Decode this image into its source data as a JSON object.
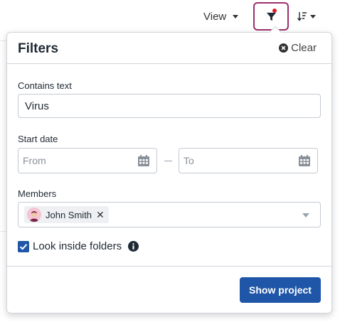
{
  "toolbar": {
    "view_label": "View",
    "filter_icon": "filter-icon",
    "filter_active_color": "#e11d2a",
    "sort_icon": "sort-icon"
  },
  "filters": {
    "title": "Filters",
    "clear_label": "Clear",
    "contains_text": {
      "label": "Contains text",
      "value": "Virus"
    },
    "start_date": {
      "label": "Start date",
      "from_placeholder": "From",
      "to_placeholder": "To"
    },
    "members": {
      "label": "Members",
      "selected": [
        {
          "name": "John Smith"
        }
      ]
    },
    "look_inside_folders": {
      "label": "Look inside folders",
      "checked": true
    },
    "submit_label": "Show project"
  },
  "colors": {
    "accent": "#1f56a8",
    "filter_border": "#9c2f6e"
  }
}
